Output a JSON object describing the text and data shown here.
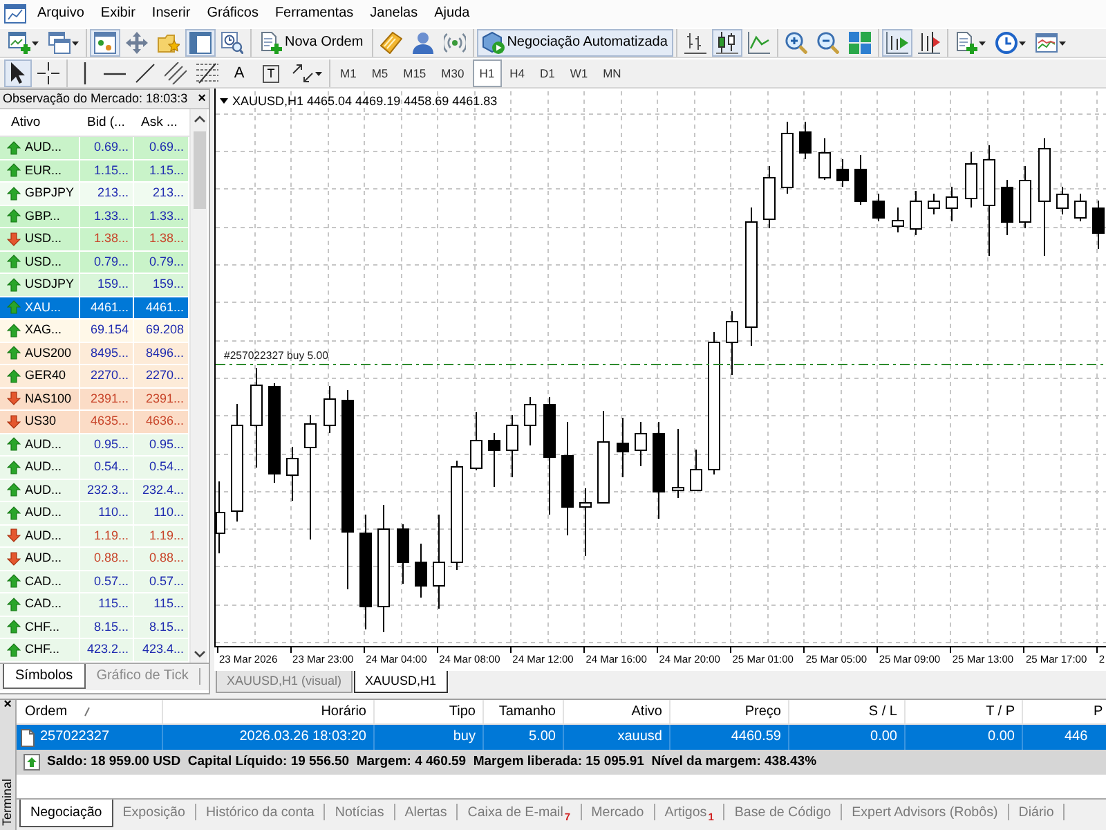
{
  "menu": {
    "items": [
      "Arquivo",
      "Exibir",
      "Inserir",
      "Gráficos",
      "Ferramentas",
      "Janelas",
      "Ajuda"
    ]
  },
  "toolbar_1": [
    [
      {
        "kind": "menu",
        "pressed": false
      },
      {
        "kind": "menu",
        "pressed": false
      }
    ],
    [
      {
        "kind": "icon",
        "pressed": true
      },
      {
        "kind": "icon",
        "pressed": false
      },
      {
        "kind": "icon",
        "pressed": false
      },
      {
        "kind": "icon",
        "pressed": true
      },
      {
        "kind": "icon",
        "pressed": false
      }
    ],
    [
      {
        "kind": "text",
        "label": "Nova Ordem",
        "pressed": false
      }
    ],
    [
      {
        "kind": "icon",
        "pressed": false
      },
      {
        "kind": "icon",
        "pressed": false
      },
      {
        "kind": "icon",
        "pressed": false
      }
    ],
    [
      {
        "kind": "text",
        "label": "Negociação Automatizada",
        "pressed": true
      }
    ],
    [
      {
        "kind": "icon",
        "pressed": false
      },
      {
        "kind": "icon",
        "pressed": true
      },
      {
        "kind": "icon",
        "pressed": false
      }
    ],
    [
      {
        "kind": "icon",
        "pressed": false
      },
      {
        "kind": "icon",
        "pressed": false
      },
      {
        "kind": "icon",
        "pressed": false
      }
    ],
    [
      {
        "kind": "icon",
        "pressed": true
      },
      {
        "kind": "icon",
        "pressed": false
      }
    ],
    [
      {
        "kind": "menu",
        "pressed": false
      },
      {
        "kind": "menu",
        "pressed": false
      },
      {
        "kind": "menu",
        "pressed": false
      }
    ]
  ],
  "toolbar_2": [
    [
      {
        "kind": "icon",
        "pressed": true
      },
      {
        "kind": "icon",
        "pressed": false
      }
    ],
    [
      {
        "kind": "icon",
        "pressed": false
      },
      {
        "kind": "icon",
        "pressed": false
      },
      {
        "kind": "icon",
        "pressed": false
      },
      {
        "kind": "icon",
        "pressed": false
      },
      {
        "kind": "icon",
        "pressed": false
      },
      {
        "kind": "glyph",
        "label": "A",
        "framed": false,
        "pressed": false
      },
      {
        "kind": "glyph",
        "label": "T",
        "framed": true,
        "pressed": false
      },
      {
        "kind": "menu",
        "pressed": false
      }
    ],
    [
      {
        "kind": "period",
        "label": "M1",
        "selected": false
      },
      {
        "kind": "period",
        "label": "M5",
        "selected": false
      },
      {
        "kind": "period",
        "label": "M15",
        "selected": false
      },
      {
        "kind": "period",
        "label": "M30",
        "selected": false
      },
      {
        "kind": "period",
        "label": "H1",
        "selected": true
      },
      {
        "kind": "period",
        "label": "H4",
        "selected": false
      },
      {
        "kind": "period",
        "label": "D1",
        "selected": false
      },
      {
        "kind": "period",
        "label": "W1",
        "selected": false
      },
      {
        "kind": "period",
        "label": "MN",
        "selected": false
      }
    ]
  ],
  "market_watch": {
    "title": "Observação do Mercado: 18:03:3",
    "close": "×",
    "columns": [
      "Ativo",
      "Bid (...",
      "Ask ..."
    ],
    "rows": [
      {
        "symbol": "AUD...",
        "bid": "0.69...",
        "ask": "0.69...",
        "rising": true,
        "color": "#c9f3c9",
        "selected": false
      },
      {
        "symbol": "EUR...",
        "bid": "1.15...",
        "ask": "1.15...",
        "rising": true,
        "color": "#c9f3c9",
        "selected": false
      },
      {
        "symbol": "GBPJPY",
        "bid": "213...",
        "ask": "213...",
        "rising": true,
        "color": "#f0fbf0",
        "selected": false
      },
      {
        "symbol": "GBP...",
        "bid": "1.33...",
        "ask": "1.33...",
        "rising": true,
        "color": "#c9f3c9",
        "selected": false
      },
      {
        "symbol": "USD...",
        "bid": "1.38...",
        "ask": "1.38...",
        "rising": false,
        "color": "#c9f3c9",
        "selected": false
      },
      {
        "symbol": "USD...",
        "bid": "0.79...",
        "ask": "0.79...",
        "rising": true,
        "color": "#c9f3c9",
        "selected": false
      },
      {
        "symbol": "USDJPY",
        "bid": "159...",
        "ask": "159...",
        "rising": true,
        "color": "#d9f6d9",
        "selected": false
      },
      {
        "symbol": "XAU...",
        "bid": "4461...",
        "ask": "4461...",
        "rising": true,
        "selected": true
      },
      {
        "symbol": "XAG...",
        "bid": "69.154",
        "ask": "69.208",
        "rising": true,
        "color": "#fff8e8",
        "selected": false
      },
      {
        "symbol": "AUS200",
        "bid": "8495...",
        "ask": "8496...",
        "rising": true,
        "color": "#fdebd8",
        "selected": false
      },
      {
        "symbol": "GER40",
        "bid": "2270...",
        "ask": "2270...",
        "rising": true,
        "color": "#fdebd8",
        "selected": false
      },
      {
        "symbol": "NAS100",
        "bid": "2391...",
        "ask": "2391...",
        "rising": false,
        "color": "#fbdcc6",
        "selected": false
      },
      {
        "symbol": "US30",
        "bid": "4635...",
        "ask": "4636...",
        "rising": false,
        "color": "#fbdcc6",
        "selected": false
      },
      {
        "symbol": "AUD...",
        "bid": "0.95...",
        "ask": "0.95...",
        "rising": true,
        "color": "#eaf8ea",
        "selected": false
      },
      {
        "symbol": "AUD...",
        "bid": "0.54...",
        "ask": "0.54...",
        "rising": true,
        "color": "#eaf8ea",
        "selected": false
      },
      {
        "symbol": "AUD...",
        "bid": "232.3...",
        "ask": "232.4...",
        "rising": true,
        "color": "#eaf8ea",
        "selected": false
      },
      {
        "symbol": "AUD...",
        "bid": "110...",
        "ask": "110...",
        "rising": true,
        "color": "#eaf8ea",
        "selected": false
      },
      {
        "symbol": "AUD...",
        "bid": "1.19...",
        "ask": "1.19...",
        "rising": false,
        "color": "#eaf8ea",
        "selected": false
      },
      {
        "symbol": "AUD...",
        "bid": "0.88...",
        "ask": "0.88...",
        "rising": false,
        "color": "#eaf8ea",
        "selected": false
      },
      {
        "symbol": "CAD...",
        "bid": "0.57...",
        "ask": "0.57...",
        "rising": true,
        "color": "#eaf8ea",
        "selected": false
      },
      {
        "symbol": "CAD...",
        "bid": "115...",
        "ask": "115...",
        "rising": true,
        "color": "#eaf8ea",
        "selected": false
      },
      {
        "symbol": "CHF...",
        "bid": "8.15...",
        "ask": "8.15...",
        "rising": true,
        "color": "#eaf8ea",
        "selected": false
      },
      {
        "symbol": "CHF...",
        "bid": "423.2...",
        "ask": "423.4...",
        "rising": true,
        "color": "#eaf8ea",
        "selected": false
      }
    ],
    "tabs": [
      {
        "label": "Símbolos",
        "selected": true
      },
      {
        "label": "Gráfico de Tick",
        "selected": false
      }
    ]
  },
  "chart": {
    "title": "XAUUSD,H1 4465.04 4469.19 4458.69 4461.83",
    "order_label": "#257022327 buy 5.00",
    "time_axis": [
      "23 Mar 2026",
      "23 Mar 23:00",
      "24 Mar 04:00",
      "24 Mar 08:00",
      "24 Mar 12:00",
      "24 Mar 16:00",
      "24 Mar 20:00",
      "25 Mar 01:00",
      "25 Mar 05:00",
      "25 Mar 09:00",
      "25 Mar 13:00",
      "25 Mar 17:00",
      "2"
    ]
  },
  "chart_tabs": [
    {
      "label": "XAUUSD,H1 (visual)",
      "selected": false
    },
    {
      "label": "XAUUSD,H1",
      "selected": true
    }
  ],
  "terminal": {
    "side_label": "Terminal",
    "close": "×",
    "columns": [
      "Ordem",
      "Horário",
      "Tipo",
      "Tamanho",
      "Ativo",
      "Preço",
      "S / L",
      "T / P",
      "P"
    ],
    "rows": [
      {
        "selected": true,
        "cells": [
          "257022327",
          "2026.03.26 18:03:20",
          "buy",
          "5.00",
          "xauusd",
          "4460.59",
          "0.00",
          "0.00",
          "446"
        ]
      }
    ],
    "summary": "Saldo: 18 959.00 USD  Capital Líquido: 19 556.50  Margem: 4 460.59  Margem liberada: 15 095.91  Nível da margem: 438.43%",
    "tabs": [
      {
        "label": "Negociação",
        "selected": true
      },
      {
        "label": "Exposição",
        "selected": false
      },
      {
        "label": "Histórico da conta",
        "selected": false
      },
      {
        "label": "Notícias",
        "selected": false
      },
      {
        "label": "Alertas",
        "selected": false
      },
      {
        "label": "Caixa de E-mail",
        "badge": "7",
        "selected": false
      },
      {
        "label": "Mercado",
        "selected": false
      },
      {
        "label": "Artigos",
        "badge": "1",
        "selected": false
      },
      {
        "label": "Base de Código",
        "selected": false
      },
      {
        "label": "Expert Advisors (Robôs)",
        "selected": false
      },
      {
        "label": "Diário",
        "selected": false
      }
    ]
  }
}
